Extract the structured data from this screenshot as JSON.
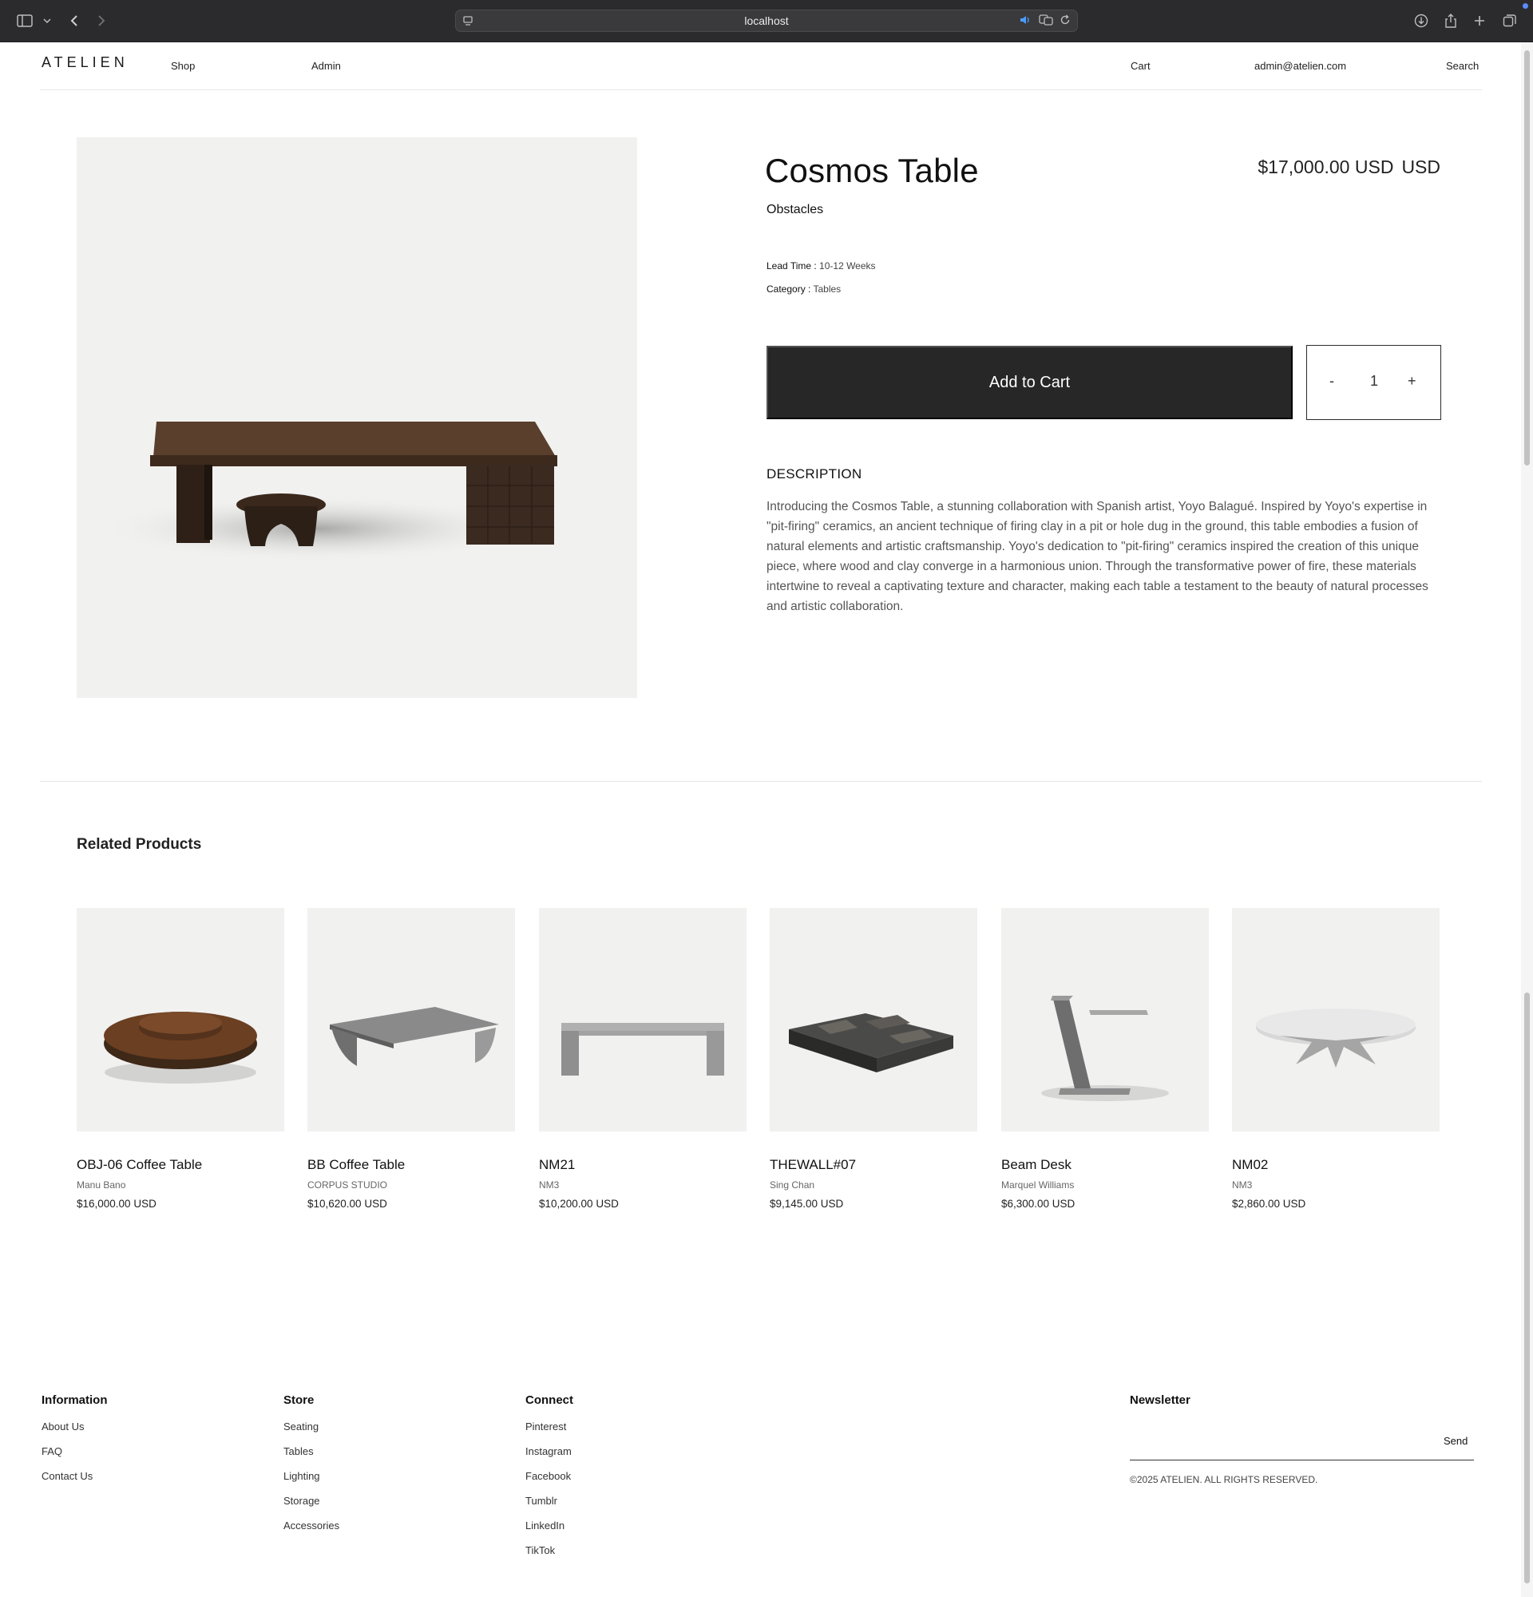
{
  "browser": {
    "url": "localhost"
  },
  "header": {
    "logo": "ATELIEN",
    "nav": {
      "shop": "Shop",
      "admin": "Admin",
      "cart": "Cart",
      "account": "admin@atelien.com",
      "search": "Search"
    }
  },
  "product": {
    "title": "Cosmos Table",
    "price": "$17,000.00 USD",
    "currency": "USD",
    "vendor": "Obstacles",
    "lead_time_label": "Lead Time :",
    "lead_time": "10-12 Weeks",
    "category_label": "Category :",
    "category": "Tables",
    "add_to_cart": "Add to Cart",
    "qty_minus": "-",
    "quantity": "1",
    "qty_plus": "+",
    "description_heading": "DESCRIPTION",
    "description": "Introducing the Cosmos Table, a stunning collaboration with Spanish artist, Yoyo Balagué. Inspired by Yoyo's expertise in \"pit-firing\" ceramics, an ancient technique of firing clay in a pit or hole dug in the ground, this table embodies a fusion of natural elements and artistic craftsmanship. Yoyo's dedication to \"pit-firing\" ceramics inspired the creation of this unique piece, where wood and clay converge in a harmonious union. Through the transformative power of fire, these materials intertwine to reveal a captivating texture and character, making each table a testament to the beauty of natural processes and artistic collaboration."
  },
  "related": {
    "heading": "Related Products",
    "items": [
      {
        "name": "OBJ-06 Coffee Table",
        "brand": "Manu Bano",
        "price": "$16,000.00 USD"
      },
      {
        "name": "BB Coffee Table",
        "brand": "CORPUS STUDIO",
        "price": "$10,620.00 USD"
      },
      {
        "name": "NM21",
        "brand": "NM3",
        "price": "$10,200.00 USD"
      },
      {
        "name": "THEWALL#07",
        "brand": "Sing Chan",
        "price": "$9,145.00 USD"
      },
      {
        "name": "Beam Desk",
        "brand": "Marquel Williams",
        "price": "$6,300.00 USD"
      },
      {
        "name": "NM02",
        "brand": "NM3",
        "price": "$2,860.00 USD"
      }
    ]
  },
  "footer": {
    "information": {
      "heading": "Information",
      "links": [
        "About Us",
        "FAQ",
        "Contact Us"
      ]
    },
    "store": {
      "heading": "Store",
      "links": [
        "Seating",
        "Tables",
        "Lighting",
        "Storage",
        "Accessories"
      ]
    },
    "connect": {
      "heading": "Connect",
      "links": [
        "Pinterest",
        "Instagram",
        "Facebook",
        "Tumblr",
        "LinkedIn",
        "TikTok"
      ]
    },
    "newsletter": {
      "heading": "Newsletter",
      "email_value": "",
      "send": "Send"
    },
    "copyright": "©2025 ATELIEN. ALL RIGHTS RESERVED."
  },
  "colors": {
    "button_bg": "#272727",
    "image_bg": "#f1f1f0",
    "chrome_bg": "#2b2b2d"
  }
}
